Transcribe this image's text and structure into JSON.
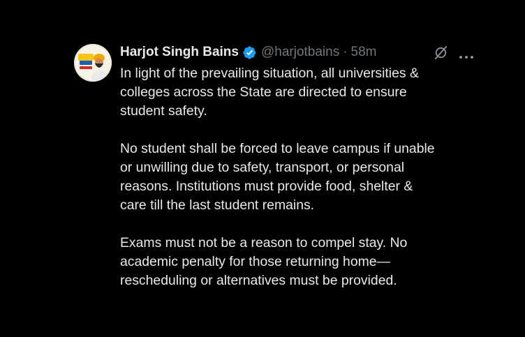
{
  "tweet": {
    "author": {
      "display_name": "Harjot Singh Bains",
      "handle": "@harjotbains",
      "verified_icon": "verified-badge-icon",
      "avatar_icon": "profile-avatar"
    },
    "separator": "·",
    "timestamp": "58m",
    "actions": {
      "grok_icon": "grok-icon",
      "more_icon": "more-options-icon"
    },
    "paragraphs": [
      {
        "lines": [
          "In light of the prevailing situation, all universities &",
          "colleges across the State are directed to ensure",
          "student safety."
        ]
      },
      {
        "lines": [
          "No student shall be forced to leave campus if unable",
          "or unwilling due to safety, transport, or personal",
          "reasons. Institutions must provide food, shelter &",
          "care till the last student remains."
        ]
      },
      {
        "lines": [
          "Exams must not be a reason to compel stay. No",
          "academic penalty for those returning home—",
          "rescheduling or alternatives must be provided."
        ]
      }
    ]
  },
  "colors": {
    "background": "#000000",
    "primary_text": "#e7e9ea",
    "secondary_text": "#71767b",
    "verified_blue": "#1d9bf0"
  }
}
